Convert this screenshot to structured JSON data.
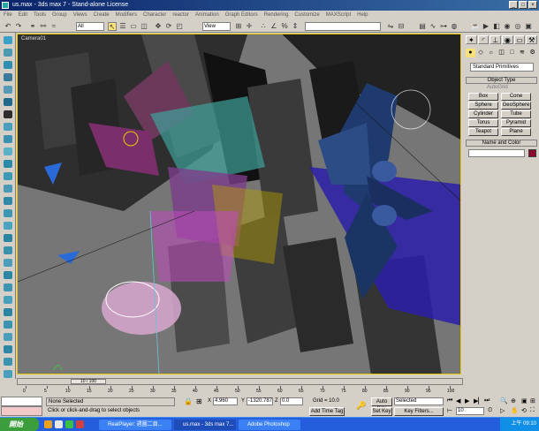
{
  "window": {
    "title": "us.max - 3ds max 7 - Stand-alone License",
    "controls": [
      "_",
      "□",
      "×"
    ]
  },
  "menu": [
    "File",
    "Edit",
    "Tools",
    "Group",
    "Views",
    "Create",
    "Modifiers",
    "Character",
    "reactor",
    "Animation",
    "Graph Editors",
    "Rendering",
    "Customize",
    "MAXScript",
    "Help"
  ],
  "toolbar": {
    "selection_filter": "All",
    "reference_coord": "View",
    "named_selection": ""
  },
  "viewport": {
    "label": "Camera01"
  },
  "command_panel": {
    "category": "Standard Primitives",
    "object_type_title": "Object Type",
    "autogrid": "AutoGrid",
    "buttons": [
      "Box",
      "Cone",
      "Sphere",
      "GeoSphere",
      "Cylinder",
      "Tube",
      "Torus",
      "Pyramid",
      "Teapot",
      "Plane"
    ],
    "name_color_title": "Name and Color",
    "name_value": "",
    "color": "#8b0a2c"
  },
  "time_slider": {
    "frame_label": "10 / 100",
    "ticks": [
      "0",
      "5",
      "10",
      "15",
      "20",
      "25",
      "30",
      "35",
      "40",
      "45",
      "50",
      "55",
      "60",
      "65",
      "70",
      "75",
      "80",
      "85",
      "90",
      "95",
      "100"
    ]
  },
  "status": {
    "selection": "None Selected",
    "prompt": "Click or click-and-drag to select objects",
    "x_label": "X",
    "x_value": "4.960",
    "y_label": "Y",
    "y_value": "-1320.787",
    "z_label": "Z",
    "z_value": "0.0",
    "grid": "Grid = 10.0",
    "add_time_tag": "Add Time Tag",
    "auto_key": "Auto Key",
    "set_key": "Set Key",
    "key_mode": "Selected",
    "key_filters": "Key Filters...",
    "current_frame": "10"
  },
  "taskbar": {
    "start": "開始",
    "tasks": [
      "RealPlayer: 週圖二頁...",
      "us.max - 3ds max 7...",
      "Adobe Photoshop"
    ],
    "clock": "上午 09:10"
  }
}
